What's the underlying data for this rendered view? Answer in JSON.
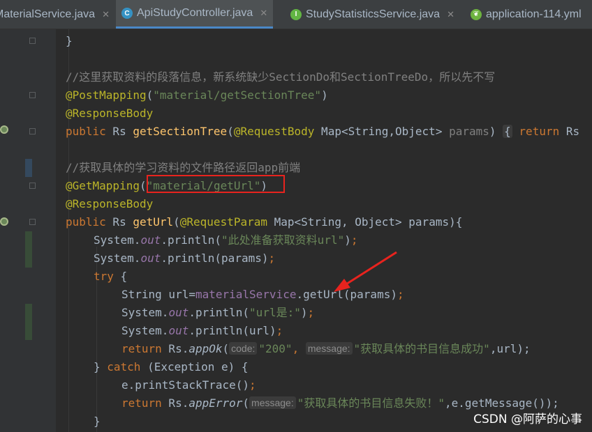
{
  "tabs": [
    {
      "label": "MaterialService.java",
      "icon": "interface-icon"
    },
    {
      "label": "ApiStudyController.java",
      "icon": "class-icon",
      "active": true
    },
    {
      "label": "StudyStatisticsService.java",
      "icon": "interface-icon"
    },
    {
      "label": "application-114.yml",
      "icon": "spring-yml-icon"
    }
  ],
  "code": {
    "l1": "}",
    "l2_comment": "//这里获取资料的段落信息，新系统缺少SectionDo和SectionTreeDo，所以先不写",
    "l3_anno": "@PostMapping",
    "l3_str": "\"material/getSectionTree\"",
    "l4_anno": "@ResponseBody",
    "l5_public": "public",
    "l5_type": " Rs ",
    "l5_fn": "getSectionTree",
    "l5_anno": "@RequestBody",
    "l5_params": " Map<String,Object> ",
    "l5_pname": "params",
    "l5_brace": "{",
    "l5_return": "return",
    "l5_tail": " Rs",
    "l7_comment": "//获取具体的学习资料的文件路径返回app前端",
    "l8_anno": "@GetMapping",
    "l8_str": "\"material/getUrl\"",
    "l9_anno": "@ResponseBody",
    "l10_public": "public",
    "l10_type": " Rs ",
    "l10_fn": "getUrl",
    "l10_anno": "@RequestParam",
    "l10_rest": " Map<String, Object> params){",
    "sys": "System.",
    "out": "out",
    "println": ".println(",
    "l11_str": "\"此处准备获取资料url\"",
    "l12_arg": "params",
    "l13_try": "try",
    "l14_type": "String url=",
    "l14_field": "materialService",
    "l14_call": ".getUrl(params)",
    "l15_str": "\"url是:\"",
    "l16_arg": "url",
    "ret": "return",
    "rs": " Rs.",
    "l17_fn": "appOk",
    "l17_hint1": "code:",
    "l17_str1": "\"200\"",
    "l17_hint2": "message:",
    "l17_str2": "\"获取具体的书目信息成功\"",
    "l17_tail": ",url);",
    "l18_catch": "catch",
    "l18_rest": " (Exception e) {",
    "l19": "e.printStackTrace()",
    "l20_fn": "appError",
    "l20_hint": "message:",
    "l20_str": "\"获取具体的书目信息失败！\"",
    "l20_tail": ",e.getMessage());"
  },
  "watermark": "CSDN @阿萨的心事",
  "colors": {
    "keyword": "#cc7832",
    "annotation": "#bbb529",
    "string": "#6a8759",
    "comment": "#808080",
    "field": "#9876aa",
    "method": "#ffc66d",
    "highlight": "#e8231e"
  }
}
